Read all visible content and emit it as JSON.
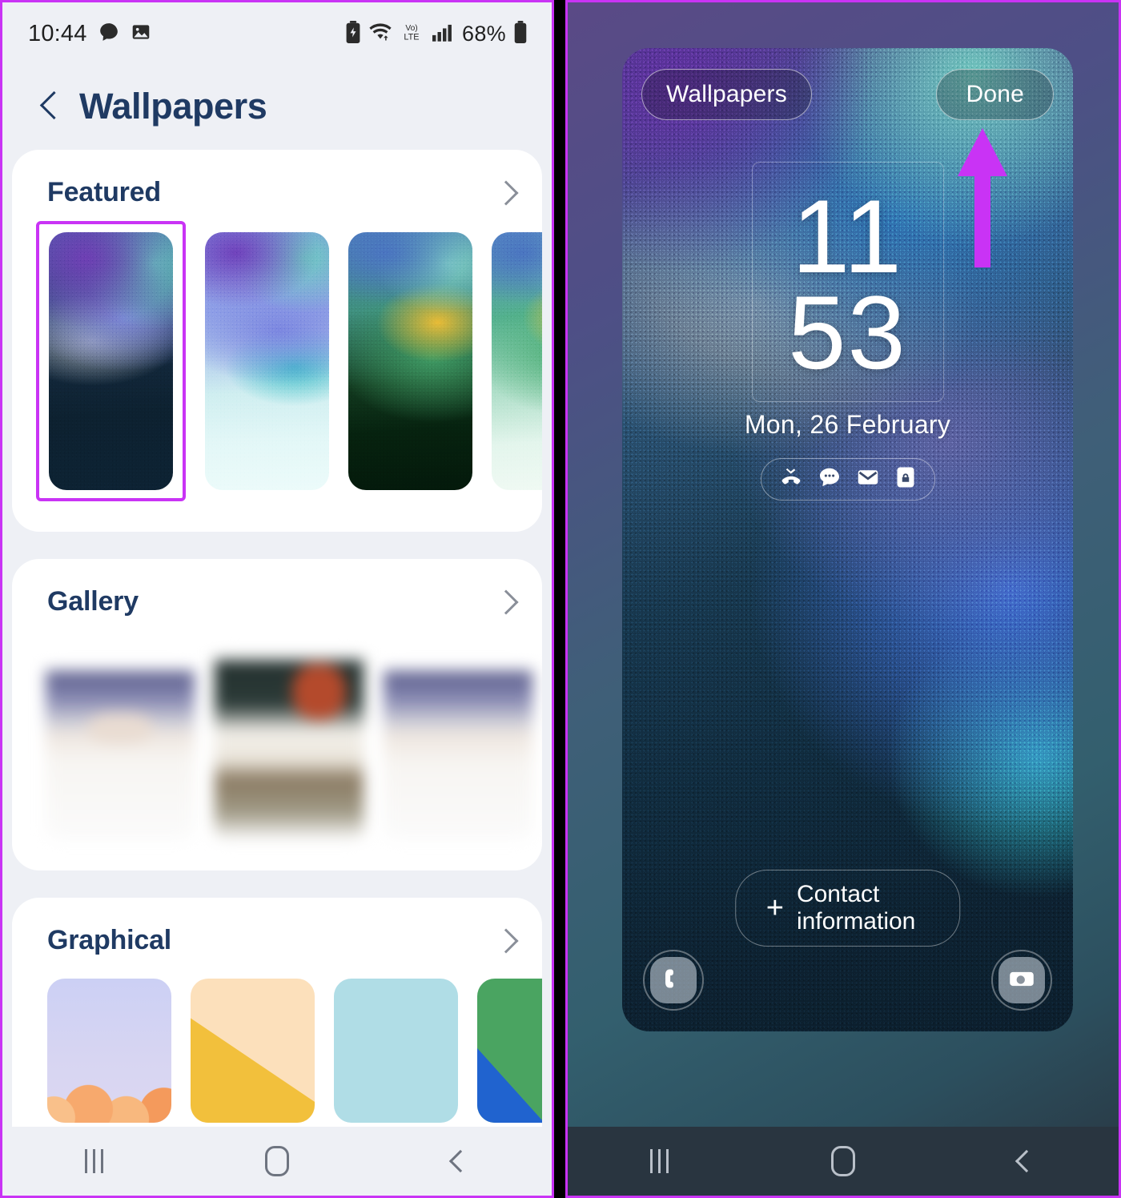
{
  "left_phone": {
    "status_bar": {
      "time": "10:44",
      "battery_percent": "68%",
      "left_icons": [
        "chat-bubble-icon",
        "image-icon"
      ],
      "right_icons": [
        "battery-saver-icon",
        "wifi-icon",
        "volte-icon",
        "signal-bars-icon",
        "battery-icon"
      ],
      "volte_label": "Vo) LTE"
    },
    "header": {
      "back_icon": "back-chevron-icon",
      "title": "Wallpapers"
    },
    "sections": [
      {
        "title": "Featured",
        "chevron": "chevron-right-icon",
        "items": [
          {
            "name": "featured-wallpaper-1",
            "selected": true
          },
          {
            "name": "featured-wallpaper-2",
            "selected": false
          },
          {
            "name": "featured-wallpaper-3",
            "selected": false
          },
          {
            "name": "featured-wallpaper-4",
            "selected": false
          }
        ]
      },
      {
        "title": "Gallery",
        "chevron": "chevron-right-icon",
        "items": [
          {
            "name": "gallery-photo-1"
          },
          {
            "name": "gallery-photo-2"
          },
          {
            "name": "gallery-photo-3"
          },
          {
            "name": "gallery-photo-4"
          }
        ]
      },
      {
        "title": "Graphical",
        "chevron": "chevron-right-icon",
        "items": [
          {
            "name": "graphical-wallpaper-1"
          },
          {
            "name": "graphical-wallpaper-2"
          },
          {
            "name": "graphical-wallpaper-3"
          },
          {
            "name": "graphical-wallpaper-4"
          }
        ]
      }
    ],
    "nav_bar": {
      "recents": "recents-icon",
      "home": "home-icon",
      "back": "back-icon"
    }
  },
  "right_phone": {
    "top_bar": {
      "wallpapers_label": "Wallpapers",
      "done_label": "Done"
    },
    "lock_screen": {
      "clock_hours": "11",
      "clock_minutes": "53",
      "date": "Mon, 26 February",
      "notification_icons": [
        "missed-call-icon",
        "message-bubble-icon",
        "email-icon",
        "secure-folder-icon"
      ],
      "contact_info_label": "Contact information",
      "contact_info_plus": "+",
      "shortcut_left": "phone-icon",
      "shortcut_right": "camera-icon"
    },
    "annotation": {
      "arrow": "up-arrow-annotation",
      "arrow_color": "#c933f5",
      "points_to": "Done"
    },
    "nav_bar": {
      "recents": "recents-icon",
      "home": "home-icon",
      "back": "back-icon"
    }
  },
  "theme": {
    "highlight_color": "#c933f5",
    "left_bg": "#eef0f5",
    "card_bg": "#ffffff",
    "title_color": "#1f3a63",
    "right_bg": "#293540"
  }
}
